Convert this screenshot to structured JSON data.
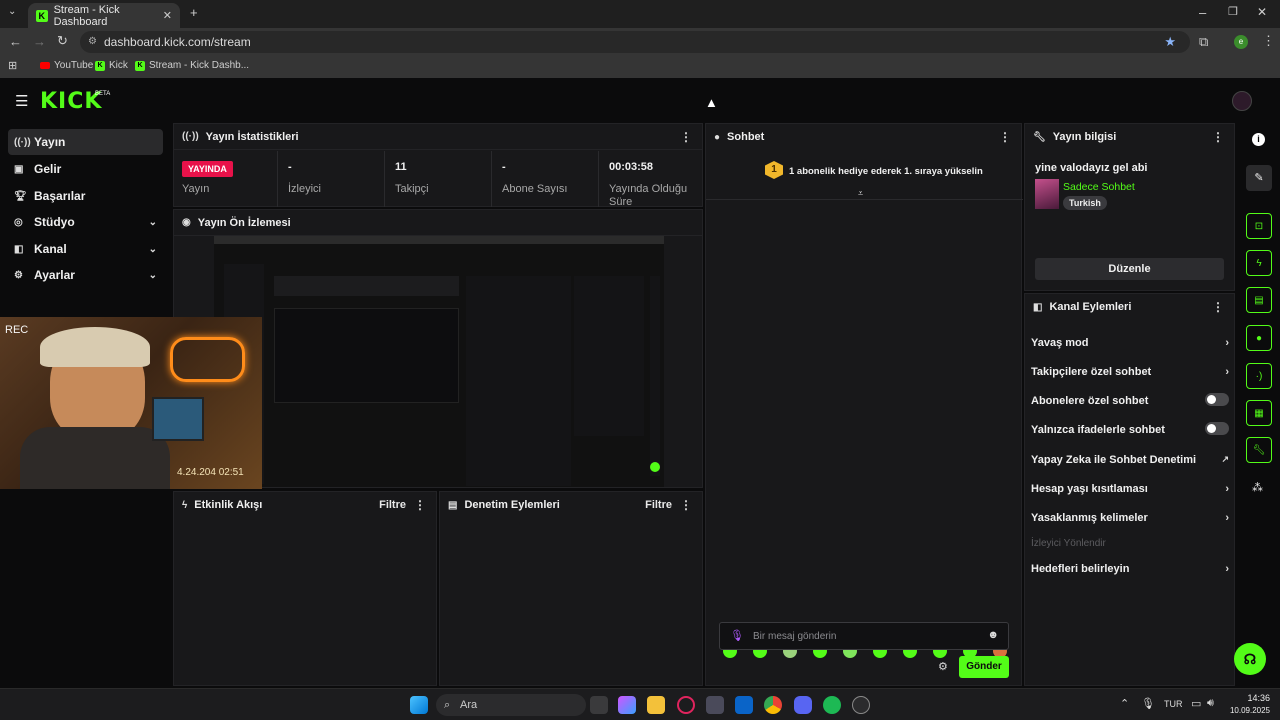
{
  "browser": {
    "tab_title": "Stream - Kick Dashboard",
    "url": "dashboard.kick.com/stream",
    "bookmarks": [
      "YouTube",
      "Kick",
      "Stream - Kick Dashb..."
    ],
    "profile_initial": "e"
  },
  "app": {
    "logo": "KICK",
    "beta": "BETA"
  },
  "sidebar": {
    "items": [
      {
        "label": "Yayın",
        "icon": "broadcast-icon"
      },
      {
        "label": "Gelir",
        "icon": "revenue-icon"
      },
      {
        "label": "Başarılar",
        "icon": "trophy-icon"
      },
      {
        "label": "Stüdyo",
        "icon": "studio-icon"
      },
      {
        "label": "Kanal",
        "icon": "channel-icon"
      },
      {
        "label": "Ayarlar",
        "icon": "gear-icon"
      }
    ]
  },
  "stats": {
    "title": "Yayın İstatistikleri",
    "live_badge": "YAYINDA",
    "items": [
      {
        "value": "",
        "label": "Yayın"
      },
      {
        "value": "-",
        "label": "İzleyici"
      },
      {
        "value": "11",
        "label": "Takipçi"
      },
      {
        "value": "-",
        "label": "Abone Sayısı"
      },
      {
        "value": "00:03:58",
        "label": "Yayında Olduğu Süre"
      }
    ]
  },
  "preview": {
    "title": "Yayın Ön İzlemesi",
    "rec": "REC",
    "timestamp": "4.24.204  02:51"
  },
  "activity": {
    "title": "Etkinlik Akışı",
    "filter": "Filtre"
  },
  "moderation": {
    "title": "Denetim Eylemleri",
    "filter": "Filtre"
  },
  "chat": {
    "title": "Sohbet",
    "promo_badge": "1",
    "promo_text": "1 abonelik hediye ederek 1. sıraya yükselin",
    "input_placeholder": "Bir mesaj gönderin",
    "send": "Gönder"
  },
  "stream_info": {
    "title": "Yayın bilgisi",
    "stream_title": "yine valodayız gel abi",
    "category": "Sadece Sohbet",
    "language_tag": "Turkish",
    "edit": "Düzenle"
  },
  "channel_actions": {
    "title": "Kanal Eylemleri",
    "items": [
      {
        "label": "Yavaş mod",
        "control": "chevron"
      },
      {
        "label": "Takipçilere özel sohbet",
        "control": "chevron"
      },
      {
        "label": "Abonelere özel sohbet",
        "control": "toggle"
      },
      {
        "label": "Yalnızca ifadelerle sohbet",
        "control": "toggle"
      },
      {
        "label": "Yapay Zeka ile Sohbet Denetimi",
        "control": "external"
      },
      {
        "label": "Hesap yaşı kısıtlaması",
        "control": "chevron"
      },
      {
        "label": "Yasaklanmış kelimeler",
        "control": "chevron"
      },
      {
        "label": "İzleyici Yönlendir",
        "control": "disabled"
      },
      {
        "label": "Hedefleri belirleyin",
        "control": "chevron"
      }
    ]
  },
  "taskbar": {
    "search": "Ara",
    "lang": "TUR",
    "time": "14:36",
    "date": "10.09.2025"
  },
  "colors": {
    "accent": "#53fc18",
    "live": "#e8124a",
    "panel": "#18181a",
    "background": "#0b0b0c"
  }
}
